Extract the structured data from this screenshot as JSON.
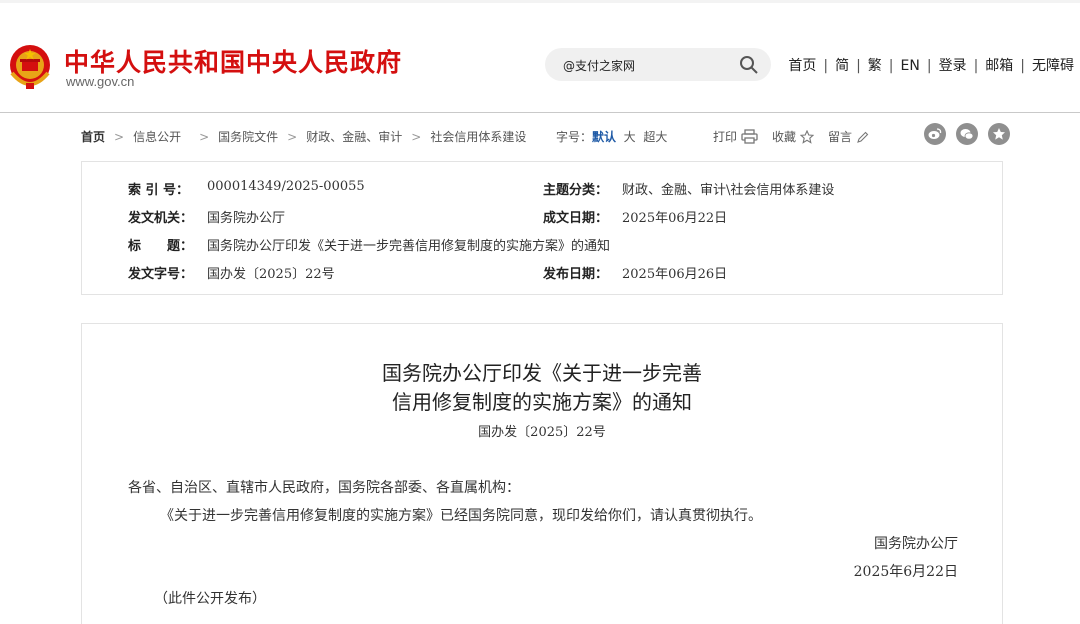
{
  "header": {
    "title": "中华人民共和国中央人民政府",
    "domain": "www.gov.cn",
    "search": {
      "value": "@支付之家网"
    },
    "nav": [
      "首页",
      "简",
      "繁",
      "EN",
      "登录",
      "邮箱",
      "无障碍"
    ]
  },
  "breadcrumb": [
    "首页",
    "信息公开",
    "国务院文件",
    "财政、金融、审计",
    "社会信用体系建设"
  ],
  "fontsize": {
    "label": "字号：",
    "options": [
      "默认",
      "大",
      "超大"
    ],
    "selected": "默认"
  },
  "tools": {
    "print": "打印",
    "favorite": "收藏",
    "comment": "留言"
  },
  "meta": {
    "index_label": "索 引 号：",
    "index_value": "000014349/2025-00055",
    "category_label": "主题分类：",
    "category_value": "财政、金融、审计\\社会信用体系建设",
    "issuer_label": "发文机关：",
    "issuer_value": "国务院办公厅",
    "created_label": "成文日期：",
    "created_value": "2025年06月22日",
    "title_label": "标　　题：",
    "title_value": "国务院办公厅印发《关于进一步完善信用修复制度的实施方案》的通知",
    "docno_label": "发文字号：",
    "docno_value": "国办发〔2025〕22号",
    "published_label": "发布日期：",
    "published_value": "2025年06月26日"
  },
  "document": {
    "title_line1": "国务院办公厅印发《关于进一步完善",
    "title_line2": "信用修复制度的实施方案》的通知",
    "number": "国办发〔2025〕22号",
    "salutation": "各省、自治区、直辖市人民政府，国务院各部委、各直属机构：",
    "body": "《关于进一步完善信用修复制度的实施方案》已经国务院同意，现印发给你们，请认真贯彻执行。",
    "signature": "国务院办公厅",
    "date": "2025年6月22日",
    "note": "（此件公开发布）"
  }
}
